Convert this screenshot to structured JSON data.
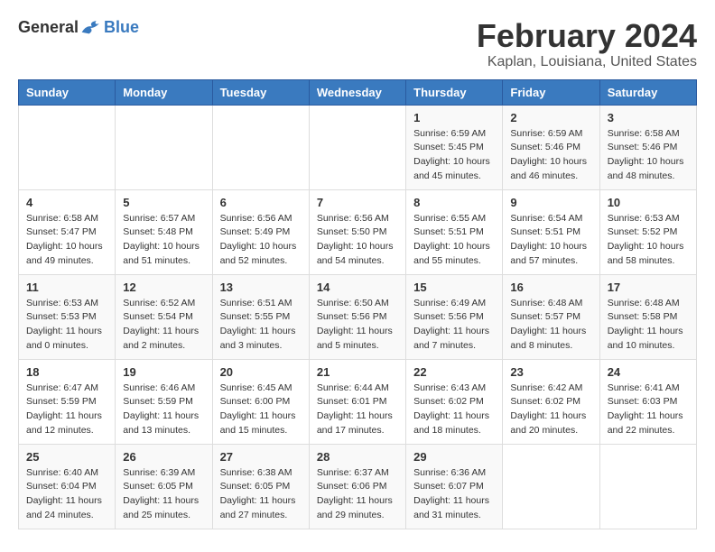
{
  "logo": {
    "general": "General",
    "blue": "Blue"
  },
  "header": {
    "month": "February 2024",
    "location": "Kaplan, Louisiana, United States"
  },
  "weekdays": [
    "Sunday",
    "Monday",
    "Tuesday",
    "Wednesday",
    "Thursday",
    "Friday",
    "Saturday"
  ],
  "weeks": [
    [
      {
        "day": "",
        "sunrise": "",
        "sunset": "",
        "daylight": ""
      },
      {
        "day": "",
        "sunrise": "",
        "sunset": "",
        "daylight": ""
      },
      {
        "day": "",
        "sunrise": "",
        "sunset": "",
        "daylight": ""
      },
      {
        "day": "",
        "sunrise": "",
        "sunset": "",
        "daylight": ""
      },
      {
        "day": "1",
        "sunrise": "Sunrise: 6:59 AM",
        "sunset": "Sunset: 5:45 PM",
        "daylight": "Daylight: 10 hours and 45 minutes."
      },
      {
        "day": "2",
        "sunrise": "Sunrise: 6:59 AM",
        "sunset": "Sunset: 5:46 PM",
        "daylight": "Daylight: 10 hours and 46 minutes."
      },
      {
        "day": "3",
        "sunrise": "Sunrise: 6:58 AM",
        "sunset": "Sunset: 5:46 PM",
        "daylight": "Daylight: 10 hours and 48 minutes."
      }
    ],
    [
      {
        "day": "4",
        "sunrise": "Sunrise: 6:58 AM",
        "sunset": "Sunset: 5:47 PM",
        "daylight": "Daylight: 10 hours and 49 minutes."
      },
      {
        "day": "5",
        "sunrise": "Sunrise: 6:57 AM",
        "sunset": "Sunset: 5:48 PM",
        "daylight": "Daylight: 10 hours and 51 minutes."
      },
      {
        "day": "6",
        "sunrise": "Sunrise: 6:56 AM",
        "sunset": "Sunset: 5:49 PM",
        "daylight": "Daylight: 10 hours and 52 minutes."
      },
      {
        "day": "7",
        "sunrise": "Sunrise: 6:56 AM",
        "sunset": "Sunset: 5:50 PM",
        "daylight": "Daylight: 10 hours and 54 minutes."
      },
      {
        "day": "8",
        "sunrise": "Sunrise: 6:55 AM",
        "sunset": "Sunset: 5:51 PM",
        "daylight": "Daylight: 10 hours and 55 minutes."
      },
      {
        "day": "9",
        "sunrise": "Sunrise: 6:54 AM",
        "sunset": "Sunset: 5:51 PM",
        "daylight": "Daylight: 10 hours and 57 minutes."
      },
      {
        "day": "10",
        "sunrise": "Sunrise: 6:53 AM",
        "sunset": "Sunset: 5:52 PM",
        "daylight": "Daylight: 10 hours and 58 minutes."
      }
    ],
    [
      {
        "day": "11",
        "sunrise": "Sunrise: 6:53 AM",
        "sunset": "Sunset: 5:53 PM",
        "daylight": "Daylight: 11 hours and 0 minutes."
      },
      {
        "day": "12",
        "sunrise": "Sunrise: 6:52 AM",
        "sunset": "Sunset: 5:54 PM",
        "daylight": "Daylight: 11 hours and 2 minutes."
      },
      {
        "day": "13",
        "sunrise": "Sunrise: 6:51 AM",
        "sunset": "Sunset: 5:55 PM",
        "daylight": "Daylight: 11 hours and 3 minutes."
      },
      {
        "day": "14",
        "sunrise": "Sunrise: 6:50 AM",
        "sunset": "Sunset: 5:56 PM",
        "daylight": "Daylight: 11 hours and 5 minutes."
      },
      {
        "day": "15",
        "sunrise": "Sunrise: 6:49 AM",
        "sunset": "Sunset: 5:56 PM",
        "daylight": "Daylight: 11 hours and 7 minutes."
      },
      {
        "day": "16",
        "sunrise": "Sunrise: 6:48 AM",
        "sunset": "Sunset: 5:57 PM",
        "daylight": "Daylight: 11 hours and 8 minutes."
      },
      {
        "day": "17",
        "sunrise": "Sunrise: 6:48 AM",
        "sunset": "Sunset: 5:58 PM",
        "daylight": "Daylight: 11 hours and 10 minutes."
      }
    ],
    [
      {
        "day": "18",
        "sunrise": "Sunrise: 6:47 AM",
        "sunset": "Sunset: 5:59 PM",
        "daylight": "Daylight: 11 hours and 12 minutes."
      },
      {
        "day": "19",
        "sunrise": "Sunrise: 6:46 AM",
        "sunset": "Sunset: 5:59 PM",
        "daylight": "Daylight: 11 hours and 13 minutes."
      },
      {
        "day": "20",
        "sunrise": "Sunrise: 6:45 AM",
        "sunset": "Sunset: 6:00 PM",
        "daylight": "Daylight: 11 hours and 15 minutes."
      },
      {
        "day": "21",
        "sunrise": "Sunrise: 6:44 AM",
        "sunset": "Sunset: 6:01 PM",
        "daylight": "Daylight: 11 hours and 17 minutes."
      },
      {
        "day": "22",
        "sunrise": "Sunrise: 6:43 AM",
        "sunset": "Sunset: 6:02 PM",
        "daylight": "Daylight: 11 hours and 18 minutes."
      },
      {
        "day": "23",
        "sunrise": "Sunrise: 6:42 AM",
        "sunset": "Sunset: 6:02 PM",
        "daylight": "Daylight: 11 hours and 20 minutes."
      },
      {
        "day": "24",
        "sunrise": "Sunrise: 6:41 AM",
        "sunset": "Sunset: 6:03 PM",
        "daylight": "Daylight: 11 hours and 22 minutes."
      }
    ],
    [
      {
        "day": "25",
        "sunrise": "Sunrise: 6:40 AM",
        "sunset": "Sunset: 6:04 PM",
        "daylight": "Daylight: 11 hours and 24 minutes."
      },
      {
        "day": "26",
        "sunrise": "Sunrise: 6:39 AM",
        "sunset": "Sunset: 6:05 PM",
        "daylight": "Daylight: 11 hours and 25 minutes."
      },
      {
        "day": "27",
        "sunrise": "Sunrise: 6:38 AM",
        "sunset": "Sunset: 6:05 PM",
        "daylight": "Daylight: 11 hours and 27 minutes."
      },
      {
        "day": "28",
        "sunrise": "Sunrise: 6:37 AM",
        "sunset": "Sunset: 6:06 PM",
        "daylight": "Daylight: 11 hours and 29 minutes."
      },
      {
        "day": "29",
        "sunrise": "Sunrise: 6:36 AM",
        "sunset": "Sunset: 6:07 PM",
        "daylight": "Daylight: 11 hours and 31 minutes."
      },
      {
        "day": "",
        "sunrise": "",
        "sunset": "",
        "daylight": ""
      },
      {
        "day": "",
        "sunrise": "",
        "sunset": "",
        "daylight": ""
      }
    ]
  ]
}
